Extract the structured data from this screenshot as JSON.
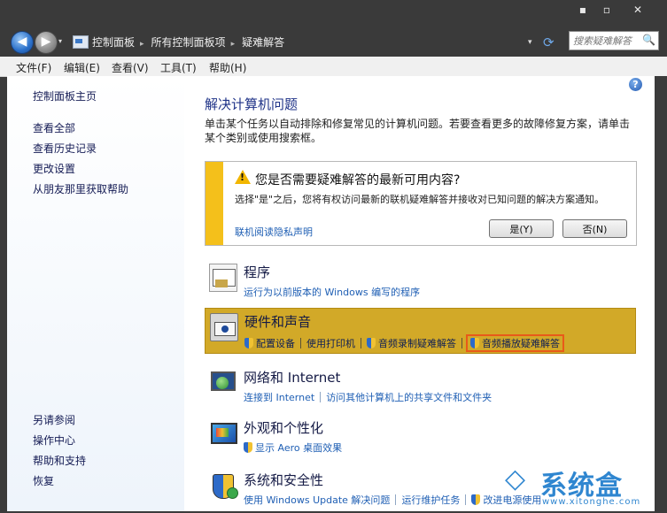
{
  "window": {
    "min": "▪",
    "max": "▫",
    "close": "✕"
  },
  "nav": {
    "back_icon": "◀",
    "forward_icon": "▶",
    "history_icon": "▾"
  },
  "breadcrumb": [
    "控制面板",
    "所有控制面板项",
    "疑难解答"
  ],
  "breadcrumb_separator": "▸",
  "search": {
    "placeholder": "搜索疑难解答",
    "icon": "🔍"
  },
  "menu": [
    "文件(F)",
    "编辑(E)",
    "查看(V)",
    "工具(T)",
    "帮助(H)"
  ],
  "sidebar": {
    "home": "控制面板主页",
    "tasks": [
      "查看全部",
      "查看历史记录",
      "更改设置",
      "从朋友那里获取帮助"
    ],
    "see_also": [
      "另请参阅",
      "操作中心",
      "帮助和支持",
      "恢复"
    ]
  },
  "main": {
    "help_icon": "?",
    "title": "解决计算机问题",
    "intro": "单击某个任务以自动排除和修复常见的计算机问题。若要查看更多的故障修复方案，请单击某个类别或使用搜索框。",
    "notice": {
      "question": "您是否需要疑难解答的最新可用内容?",
      "description": "选择\"是\"之后，您将有权访问最新的联机疑难解答并接收对已知问题的解决方案通知。",
      "privacy_link": "联机阅读隐私声明",
      "yes": "是(Y)",
      "no": "否(N)"
    },
    "categories": [
      {
        "title": "程序",
        "links": [
          "运行为以前版本的 Windows 编写的程序"
        ]
      },
      {
        "title": "硬件和声音",
        "links": [
          "配置设备",
          "使用打印机",
          "音频录制疑难解答",
          "音频播放疑难解答"
        ]
      },
      {
        "title": "网络和 Internet",
        "links": [
          "连接到 Internet",
          "访问其他计算机上的共享文件和文件夹"
        ]
      },
      {
        "title": "外观和个性化",
        "links": [
          "显示 Aero 桌面效果"
        ]
      },
      {
        "title": "系统和安全性",
        "links": [
          "使用 Windows Update 解决问题",
          "运行维护任务",
          "改进电源使用"
        ]
      }
    ]
  },
  "watermark": {
    "logo": "◇",
    "text": "系统盒",
    "url": "www.xitonghe.com"
  },
  "colors": {
    "accent": "#1f5fb4",
    "highlight": "#d2a928",
    "notice_bar": "#f4c01b",
    "callout": "#e85a1a"
  }
}
